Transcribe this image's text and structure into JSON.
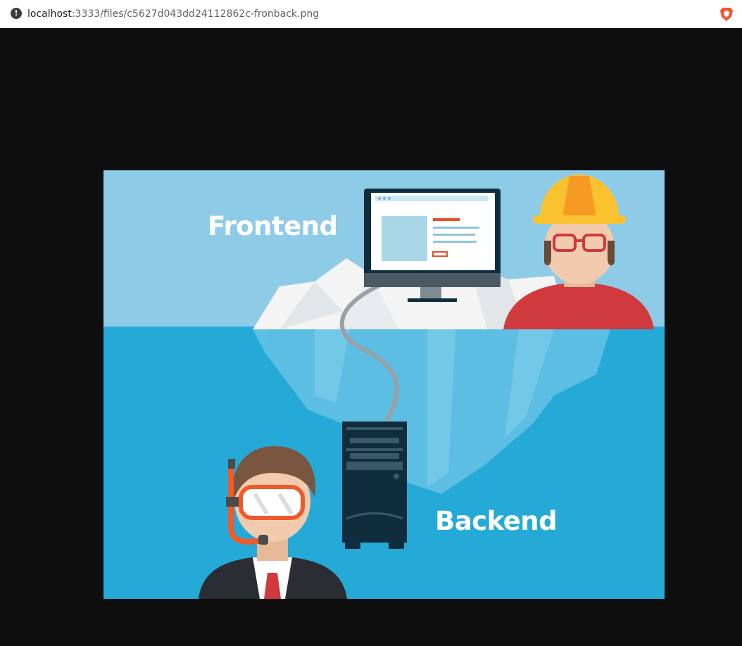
{
  "browser": {
    "url_host": "localhost",
    "url_rest": ":3333/files/c5627d043dd24112862c-fronback.png",
    "info_icon": "info-icon",
    "shield_icon": "brave-shield-icon"
  },
  "image": {
    "frontend_label": "Frontend",
    "backend_label": "Backend",
    "colors": {
      "sky": "#8ecbe6",
      "water": "#25aad8",
      "iceberg": "#f2f2f2",
      "server": "#0f2d3d",
      "helmet": "#f9c22e",
      "shirt": "#d0393e"
    }
  }
}
